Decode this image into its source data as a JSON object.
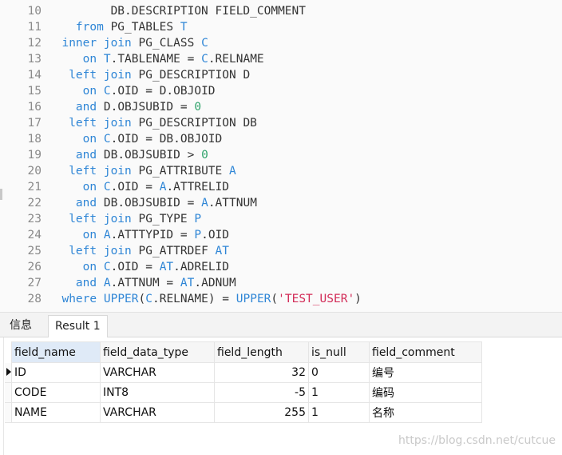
{
  "editor": {
    "lines": [
      {
        "num": "10",
        "parts": [
          {
            "t": "         DB.DESCRIPTION FIELD_COMMENT",
            "c": "plain"
          }
        ]
      },
      {
        "num": "11",
        "parts": [
          {
            "t": "    ",
            "c": "plain"
          },
          {
            "t": "from",
            "c": "kw"
          },
          {
            "t": " PG_TABLES ",
            "c": "plain"
          },
          {
            "t": "T",
            "c": "al"
          }
        ]
      },
      {
        "num": "12",
        "parts": [
          {
            "t": "  ",
            "c": "plain"
          },
          {
            "t": "inner join",
            "c": "kw"
          },
          {
            "t": " PG_CLASS ",
            "c": "plain"
          },
          {
            "t": "C",
            "c": "al"
          }
        ]
      },
      {
        "num": "13",
        "parts": [
          {
            "t": "     ",
            "c": "plain"
          },
          {
            "t": "on",
            "c": "kw"
          },
          {
            "t": " ",
            "c": "plain"
          },
          {
            "t": "T",
            "c": "al"
          },
          {
            "t": ".TABLENAME = ",
            "c": "plain"
          },
          {
            "t": "C",
            "c": "al"
          },
          {
            "t": ".RELNAME",
            "c": "plain"
          }
        ]
      },
      {
        "num": "14",
        "parts": [
          {
            "t": "   ",
            "c": "plain"
          },
          {
            "t": "left join",
            "c": "kw"
          },
          {
            "t": " PG_DESCRIPTION D",
            "c": "plain"
          }
        ]
      },
      {
        "num": "15",
        "parts": [
          {
            "t": "     ",
            "c": "plain"
          },
          {
            "t": "on",
            "c": "kw"
          },
          {
            "t": " ",
            "c": "plain"
          },
          {
            "t": "C",
            "c": "al"
          },
          {
            "t": ".OID = D.OBJOID",
            "c": "plain"
          }
        ]
      },
      {
        "num": "16",
        "parts": [
          {
            "t": "    ",
            "c": "plain"
          },
          {
            "t": "and",
            "c": "kw"
          },
          {
            "t": " D.OBJSUBID = ",
            "c": "plain"
          },
          {
            "t": "0",
            "c": "num"
          }
        ]
      },
      {
        "num": "17",
        "parts": [
          {
            "t": "   ",
            "c": "plain"
          },
          {
            "t": "left join",
            "c": "kw"
          },
          {
            "t": " PG_DESCRIPTION DB",
            "c": "plain"
          }
        ]
      },
      {
        "num": "18",
        "parts": [
          {
            "t": "     ",
            "c": "plain"
          },
          {
            "t": "on",
            "c": "kw"
          },
          {
            "t": " ",
            "c": "plain"
          },
          {
            "t": "C",
            "c": "al"
          },
          {
            "t": ".OID = DB.OBJOID",
            "c": "plain"
          }
        ]
      },
      {
        "num": "19",
        "parts": [
          {
            "t": "    ",
            "c": "plain"
          },
          {
            "t": "and",
            "c": "kw"
          },
          {
            "t": " DB.OBJSUBID > ",
            "c": "plain"
          },
          {
            "t": "0",
            "c": "num"
          }
        ]
      },
      {
        "num": "20",
        "parts": [
          {
            "t": "   ",
            "c": "plain"
          },
          {
            "t": "left join",
            "c": "kw"
          },
          {
            "t": " PG_ATTRIBUTE ",
            "c": "plain"
          },
          {
            "t": "A",
            "c": "al"
          }
        ]
      },
      {
        "num": "21",
        "parts": [
          {
            "t": "     ",
            "c": "plain"
          },
          {
            "t": "on",
            "c": "kw"
          },
          {
            "t": " ",
            "c": "plain"
          },
          {
            "t": "C",
            "c": "al"
          },
          {
            "t": ".OID = ",
            "c": "plain"
          },
          {
            "t": "A",
            "c": "al"
          },
          {
            "t": ".ATTRELID",
            "c": "plain"
          }
        ]
      },
      {
        "num": "22",
        "parts": [
          {
            "t": "    ",
            "c": "plain"
          },
          {
            "t": "and",
            "c": "kw"
          },
          {
            "t": " DB.OBJSUBID = ",
            "c": "plain"
          },
          {
            "t": "A",
            "c": "al"
          },
          {
            "t": ".ATTNUM",
            "c": "plain"
          }
        ]
      },
      {
        "num": "23",
        "parts": [
          {
            "t": "   ",
            "c": "plain"
          },
          {
            "t": "left join",
            "c": "kw"
          },
          {
            "t": " PG_TYPE ",
            "c": "plain"
          },
          {
            "t": "P",
            "c": "al"
          }
        ]
      },
      {
        "num": "24",
        "parts": [
          {
            "t": "     ",
            "c": "plain"
          },
          {
            "t": "on",
            "c": "kw"
          },
          {
            "t": " ",
            "c": "plain"
          },
          {
            "t": "A",
            "c": "al"
          },
          {
            "t": ".ATTTYPID = ",
            "c": "plain"
          },
          {
            "t": "P",
            "c": "al"
          },
          {
            "t": ".OID",
            "c": "plain"
          }
        ]
      },
      {
        "num": "25",
        "parts": [
          {
            "t": "   ",
            "c": "plain"
          },
          {
            "t": "left join",
            "c": "kw"
          },
          {
            "t": " PG_ATTRDEF ",
            "c": "plain"
          },
          {
            "t": "AT",
            "c": "al"
          }
        ]
      },
      {
        "num": "26",
        "parts": [
          {
            "t": "     ",
            "c": "plain"
          },
          {
            "t": "on",
            "c": "kw"
          },
          {
            "t": " ",
            "c": "plain"
          },
          {
            "t": "C",
            "c": "al"
          },
          {
            "t": ".OID = ",
            "c": "plain"
          },
          {
            "t": "AT",
            "c": "al"
          },
          {
            "t": ".ADRELID",
            "c": "plain"
          }
        ]
      },
      {
        "num": "27",
        "parts": [
          {
            "t": "    ",
            "c": "plain"
          },
          {
            "t": "and",
            "c": "kw"
          },
          {
            "t": " ",
            "c": "plain"
          },
          {
            "t": "A",
            "c": "al"
          },
          {
            "t": ".ATTNUM = ",
            "c": "plain"
          },
          {
            "t": "AT",
            "c": "al"
          },
          {
            "t": ".ADNUM",
            "c": "plain"
          }
        ]
      },
      {
        "num": "28",
        "parts": [
          {
            "t": "  ",
            "c": "plain"
          },
          {
            "t": "where",
            "c": "kw"
          },
          {
            "t": " ",
            "c": "plain"
          },
          {
            "t": "UPPER",
            "c": "kw"
          },
          {
            "t": "(",
            "c": "plain"
          },
          {
            "t": "C",
            "c": "al"
          },
          {
            "t": ".RELNAME) = ",
            "c": "plain"
          },
          {
            "t": "UPPER",
            "c": "kw"
          },
          {
            "t": "(",
            "c": "plain"
          },
          {
            "t": "'TEST_USER'",
            "c": "str"
          },
          {
            "t": ")",
            "c": "plain"
          }
        ]
      }
    ],
    "colors": {
      "keyword": "#2f86d6",
      "number": "#2fa36b",
      "string": "#d22b57",
      "text": "#333333",
      "line_number": "#8a8a8a"
    }
  },
  "tabs": {
    "info_label": "信息",
    "result_label": "Result 1",
    "active": "Result 1"
  },
  "results": {
    "columns": [
      "field_name",
      "field_data_type",
      "field_length",
      "is_null",
      "field_comment"
    ],
    "rows": [
      {
        "field_name": "ID",
        "field_data_type": "VARCHAR",
        "field_length": "32",
        "is_null": "0",
        "field_comment": "编号",
        "current": true
      },
      {
        "field_name": "CODE",
        "field_data_type": "INT8",
        "field_length": "-5",
        "is_null": "1",
        "field_comment": "编码",
        "current": false
      },
      {
        "field_name": "NAME",
        "field_data_type": "VARCHAR",
        "field_length": "255",
        "is_null": "1",
        "field_comment": "名称",
        "current": false
      }
    ]
  },
  "watermark": "https://blog.csdn.net/cutcue"
}
